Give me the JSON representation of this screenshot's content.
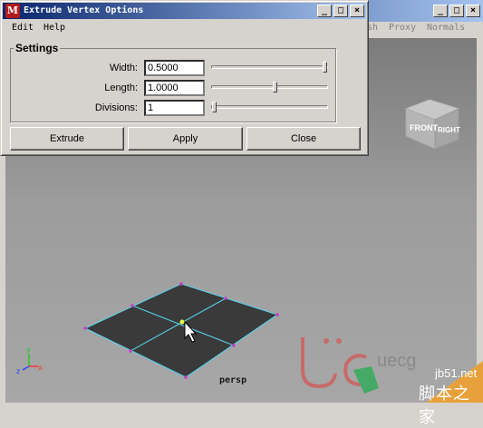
{
  "background_window": {
    "menu": [
      "sh",
      "Proxy",
      "Normals"
    ],
    "viewport": {
      "camera_label": "persp",
      "viewcube_faces": [
        "FRONT",
        "RIGHT"
      ]
    }
  },
  "dialog": {
    "title": "Extrude Vertex Options",
    "menu": [
      "Edit",
      "Help"
    ],
    "section_title": "Settings",
    "fields": [
      {
        "label": "Width:",
        "value": "0.5000",
        "slider_fraction": 1.0
      },
      {
        "label": "Length:",
        "value": "1.0000",
        "slider_fraction": 0.55
      },
      {
        "label": "Divisions:",
        "value": "1",
        "slider_fraction": 0.0
      }
    ],
    "buttons": [
      "Extrude",
      "Apply",
      "Close"
    ]
  },
  "watermark": {
    "text": "uecg",
    "site": "jb51.net",
    "cn": "脚本之家"
  },
  "colors": {
    "titlebar_start": "#08246b",
    "titlebar_end": "#a5c3ef",
    "mesh_wire": "#55d6ee",
    "mesh_face": "#3a3a3a",
    "vertex": "#c83cc8"
  }
}
